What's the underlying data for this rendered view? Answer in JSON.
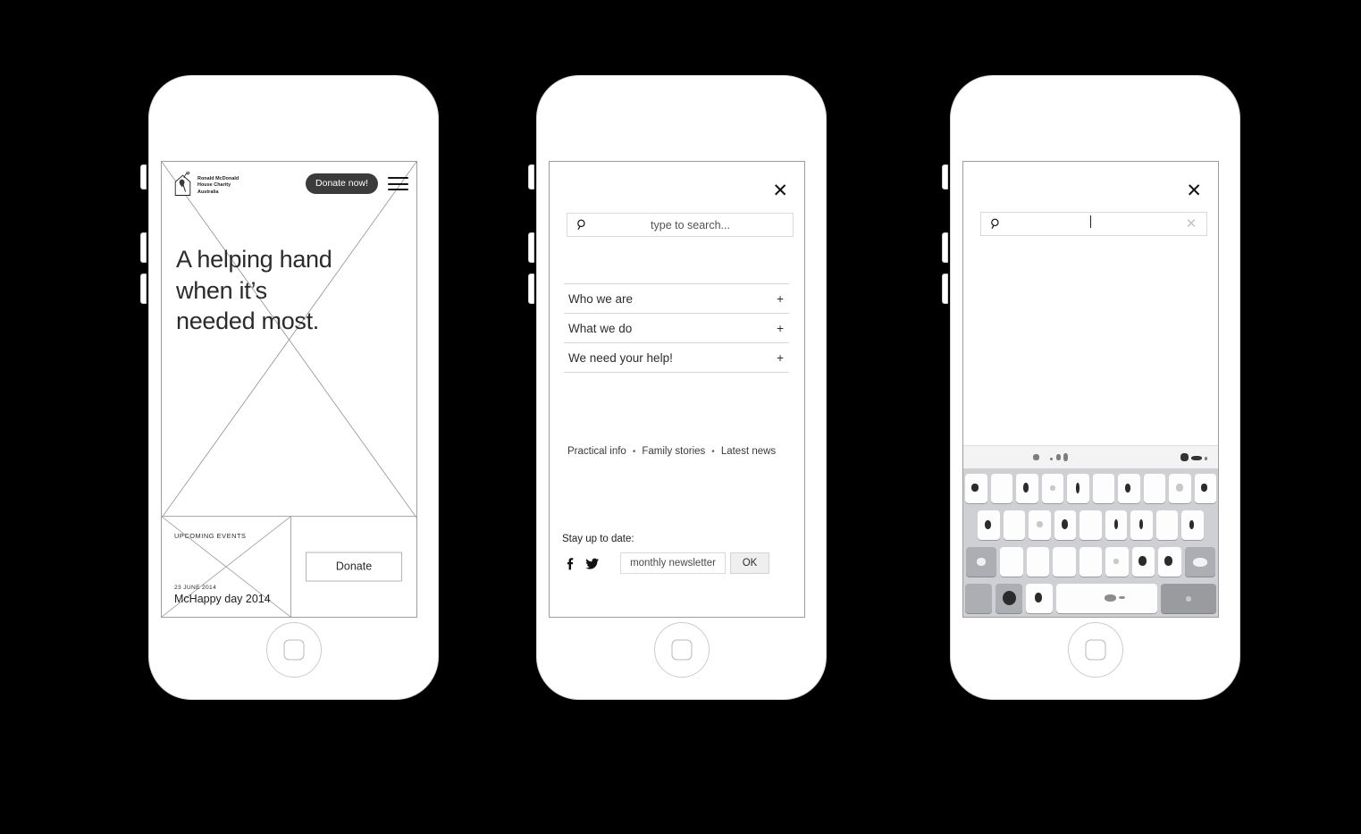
{
  "screens": [
    {
      "id": "home",
      "name": "Homepage",
      "header": {
        "logo": {
          "line1": "Ronald McDonald",
          "line2": "House Charity",
          "line3": "Australia",
          "icon": "rmhc-house-logo"
        },
        "donate_label": "Donate now!",
        "menu_icon": "hamburger-icon"
      },
      "hero": {
        "title": "A helping hand when it’s needed most."
      },
      "events": {
        "kicker": "UPCOMING EVENTS",
        "date": "23 JUNE 2014",
        "title": "McHappy day 2014",
        "donate_label": "Donate"
      }
    },
    {
      "id": "menu",
      "name": "Menu overlay",
      "close_icon": "close-icon",
      "search": {
        "placeholder": "type to search...",
        "value": "",
        "icon": "search-icon"
      },
      "nav_items": [
        {
          "label": "Who we are",
          "expander": "+"
        },
        {
          "label": "What we do",
          "expander": "+"
        },
        {
          "label": "We need your help!",
          "expander": "+"
        }
      ],
      "quick_links": [
        "Practical info",
        "Family stories",
        "Latest news"
      ],
      "quick_link_separator": "•",
      "footer": {
        "stay_label": "Stay up to date:",
        "facebook_icon": "facebook-icon",
        "twitter_icon": "twitter-icon",
        "newsletter_placeholder": "monthly newsletter",
        "newsletter_value": "",
        "ok_label": "OK"
      }
    },
    {
      "id": "search-active",
      "name": "Search active with keyboard",
      "close_icon": "close-icon",
      "search": {
        "placeholder": "",
        "value": "",
        "icon": "search-icon",
        "clear_icon": "clear-icon",
        "caret": true
      },
      "keyboard": {
        "type": "ios-qwerty",
        "rows": [
          10,
          9,
          9,
          4
        ],
        "legible": false,
        "note": "keys rendered blurred / illegible in source screenshot"
      }
    }
  ],
  "colors": {
    "page_background": "#000000",
    "phone_body": "#ffffff",
    "phone_outline": "#d5d5d5",
    "viewport_outline": "#9d9d9d",
    "donate_pill_bg": "#3b3b3b",
    "donate_pill_text": "#ffffff",
    "text_primary": "#2b2b2b",
    "rule": "#d7d7d7",
    "keyboard_bg": "#cfd0d3",
    "key_bg": "#fdfdfd",
    "key_mod_bg": "#acaeb4"
  }
}
